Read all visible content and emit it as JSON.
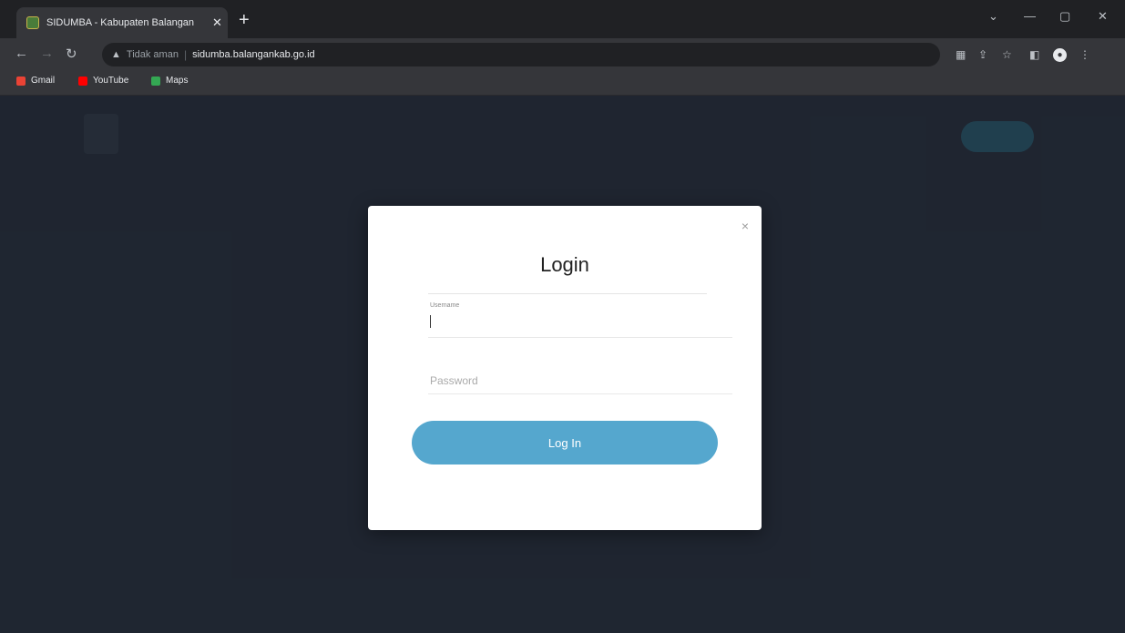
{
  "browser": {
    "tab_title": "SIDUMBA - Kabupaten Balangan",
    "tab_close": "✕",
    "new_tab": "+",
    "not_secure": "Tidak aman",
    "url": "sidumba.balangankab.go.id",
    "window": {
      "minimize": "—",
      "maximize": "▢",
      "close": "✕",
      "chevron": "⌄"
    },
    "bookmarks": [
      {
        "label": "Gmail",
        "color": "#ea4335"
      },
      {
        "label": "YouTube",
        "color": "#ff0000"
      },
      {
        "label": "Maps",
        "color": "#34a853"
      }
    ]
  },
  "modal": {
    "title": "Login",
    "close_symbol": "×",
    "username_label": "Username",
    "password_placeholder": "Password",
    "login_button": "Log In"
  },
  "colors": {
    "accent": "#55a7ce",
    "chrome_dark": "#202124",
    "chrome_mid": "#35363a"
  }
}
